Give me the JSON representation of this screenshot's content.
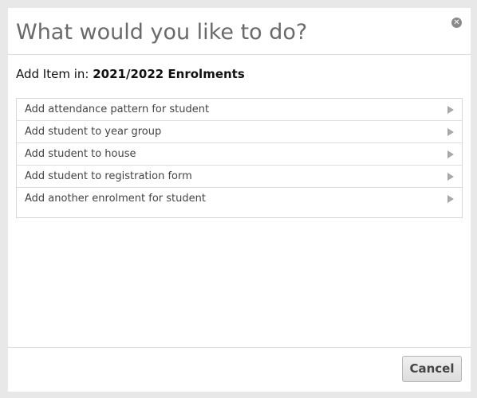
{
  "dialog": {
    "title": "What would you like to do?",
    "close_icon": "close-circle-icon"
  },
  "context": {
    "prefix": "Add Item in:",
    "name": "2021/2022 Enrolments"
  },
  "options": [
    {
      "label": "Add attendance pattern for student",
      "icon": "chevron-right-icon"
    },
    {
      "label": "Add student to year group",
      "icon": "chevron-right-icon"
    },
    {
      "label": "Add student to house",
      "icon": "chevron-right-icon"
    },
    {
      "label": "Add student to registration form",
      "icon": "chevron-right-icon"
    },
    {
      "label": "Add another enrolment for student",
      "icon": "chevron-right-icon"
    }
  ],
  "footer": {
    "cancel_label": "Cancel"
  }
}
